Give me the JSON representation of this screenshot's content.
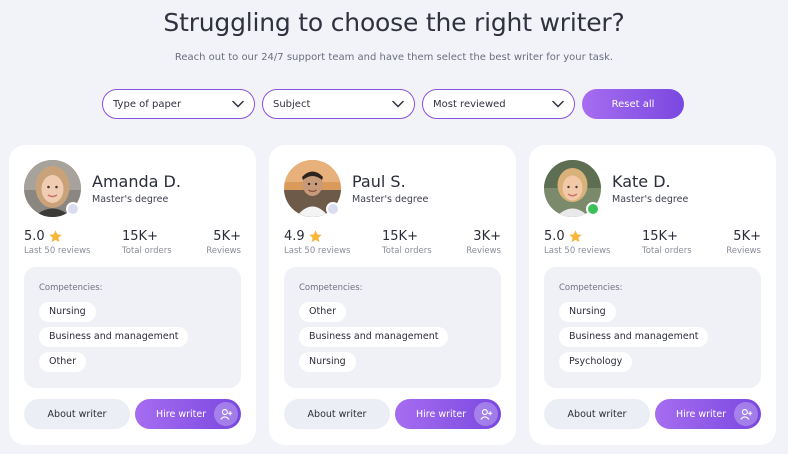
{
  "header": {
    "title": "Struggling to choose the right writer?",
    "subtitle": "Reach out to our 24/7 support team and have them select the best writer for your task."
  },
  "filters": {
    "paper_type": "Type of paper",
    "subject": "Subject",
    "sort": "Most reviewed",
    "reset_label": "Reset all"
  },
  "labels": {
    "competencies": "Competencies:",
    "last_reviews": "Last 50 reviews",
    "total_orders": "Total orders",
    "reviews": "Reviews",
    "about_writer": "About writer",
    "hire_writer": "Hire writer"
  },
  "writers": [
    {
      "name": "Amanda D.",
      "degree": "Master's degree",
      "rating": "5.0",
      "orders": "15K+",
      "reviews": "5K+",
      "online": false,
      "competencies": [
        "Nursing",
        "Business and management",
        "Other"
      ]
    },
    {
      "name": "Paul S.",
      "degree": "Master's degree",
      "rating": "4.9",
      "orders": "15K+",
      "reviews": "3K+",
      "online": false,
      "competencies": [
        "Other",
        "Business and management",
        "Nursing"
      ]
    },
    {
      "name": "Kate D.",
      "degree": "Master's degree",
      "rating": "5.0",
      "orders": "15K+",
      "reviews": "5K+",
      "online": true,
      "competencies": [
        "Nursing",
        "Business and management",
        "Psychology"
      ]
    }
  ],
  "colors": {
    "accent": "#8b50e0",
    "online": "#3cc15a",
    "offline": "#dcdcf0",
    "star": "#f5b63a"
  },
  "icons": {
    "dropdown": "chevron-down-icon",
    "rating": "star-icon",
    "hire": "add-user-icon"
  }
}
